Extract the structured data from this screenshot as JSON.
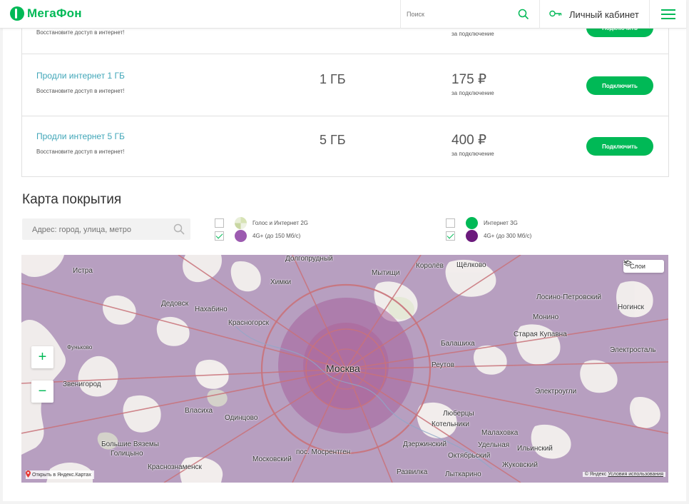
{
  "header": {
    "logo_text": "МегаФон",
    "search_placeholder": "Поиск",
    "cabinet_label": "Личный кабинет"
  },
  "offers": [
    {
      "title": "",
      "desc": "Восстановите доступ в интернет!",
      "volume": "",
      "price": "",
      "price_sub": "за подключение",
      "button": "Подключить"
    },
    {
      "title": "Продли интернет 1 ГБ",
      "desc": "Восстановите доступ в интернет!",
      "volume": "1 ГБ",
      "price": "175 ₽",
      "price_sub": "за подключение",
      "button": "Подключить"
    },
    {
      "title": "Продли интернет 5 ГБ",
      "desc": "Восстановите доступ в интернет!",
      "volume": "5 ГБ",
      "price": "400 ₽",
      "price_sub": "за подключение",
      "button": "Подключить"
    }
  ],
  "coverage": {
    "title": "Карта покрытия",
    "address_placeholder": "Адрес: город, улица, метро",
    "legend": [
      {
        "label": "Голос и Интернет 2G",
        "checked": false,
        "color": "#dfe6c8"
      },
      {
        "label": "Интернет 3G",
        "checked": false,
        "color": "#00b956"
      },
      {
        "label": "4G+ (до 150 Мб/с)",
        "checked": true,
        "color": "#9b59b6"
      },
      {
        "label": "4G+ (до 300 Мб/с)",
        "checked": true,
        "color": "#6a1b7a"
      }
    ]
  },
  "map": {
    "layers_label": "Слои",
    "zoom_in": "+",
    "zoom_out": "−",
    "open_in_yandex": "Открыть в Яндекс.Картах",
    "copyright_brand": "© Яндекс",
    "terms_link": "Условия использования",
    "labels": {
      "moscow": "Москва",
      "istra": "Истра",
      "dedovsk": "Дедовск",
      "nakhabino": "Нахабино",
      "khimki": "Химки",
      "dolgoprudny": "Долгопрудный",
      "mytishchi": "Мытищи",
      "korolev": "Королёв",
      "shchelkovo": "Щёлково",
      "losino": "Лосино-Петровский",
      "krasnogorsk": "Красногорск",
      "monino": "Монино",
      "noginsk": "Ногинск",
      "kupavna": "Старая Купавна",
      "balashikha": "Балашиха",
      "elektrostal": "Электросталь",
      "reutov": "Реутов",
      "zvenigorod": "Звенигород",
      "vlasikha": "Власиха",
      "odintsovo": "Одинцово",
      "elektrougli": "Электроугли",
      "lyubertsy": "Люберцы",
      "kotelniki": "Котельники",
      "malakhovka": "Малаховка",
      "bolshie_vyazemy": "Большие Вяземы",
      "golitsyno": "Голицыно",
      "krasnoznamensk": "Краснознаменск",
      "mosrentgen": "пос. Мосрентген",
      "dzerzhinsky": "Дзержинский",
      "oktyabrsky": "Октябрьский",
      "udelnaya": "Удельная",
      "ilyinsky": "Ильинский",
      "zhukovsky": "Жуковский",
      "moskovsky": "Московский",
      "razvilka": "Развилка",
      "lytkarino": "Лыткарино",
      "funkovo": "Фуньково"
    }
  }
}
